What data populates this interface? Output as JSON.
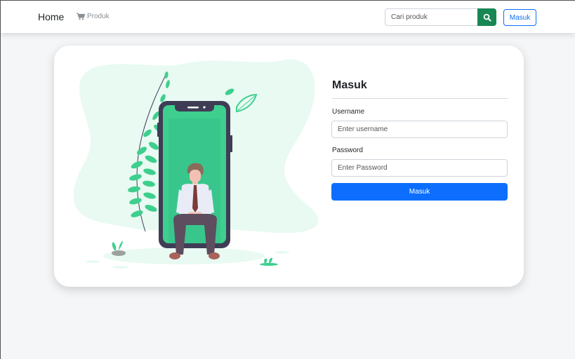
{
  "navbar": {
    "home_label": "Home",
    "produk_label": "Produk",
    "search_placeholder": "Cari produk",
    "login_button": "Masuk"
  },
  "login_form": {
    "title": "Masuk",
    "username_label": "Username",
    "username_placeholder": "Enter username",
    "password_label": "Password",
    "password_placeholder": "Enter Password",
    "submit_label": "Masuk"
  },
  "colors": {
    "primary": "#0d6efd",
    "success": "#198754",
    "illustration_green": "#3ecf8e",
    "illustration_dark": "#3f3d56"
  }
}
